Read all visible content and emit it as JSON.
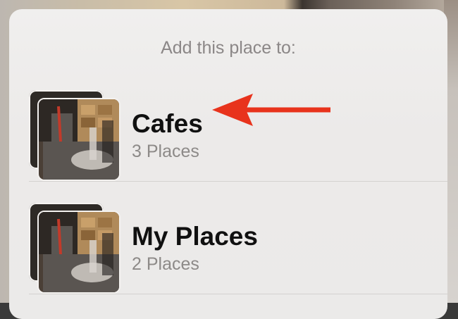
{
  "sheet": {
    "title": "Add this place to:"
  },
  "guides": [
    {
      "title": "Cafes",
      "subtitle": "3 Places",
      "thumbnail_icon": "guide-photo-thumbnail"
    },
    {
      "title": "My Places",
      "subtitle": "2 Places",
      "thumbnail_icon": "guide-photo-thumbnail"
    }
  ],
  "annotation": {
    "arrow_color": "#e8331c",
    "points_to": "Cafes"
  }
}
